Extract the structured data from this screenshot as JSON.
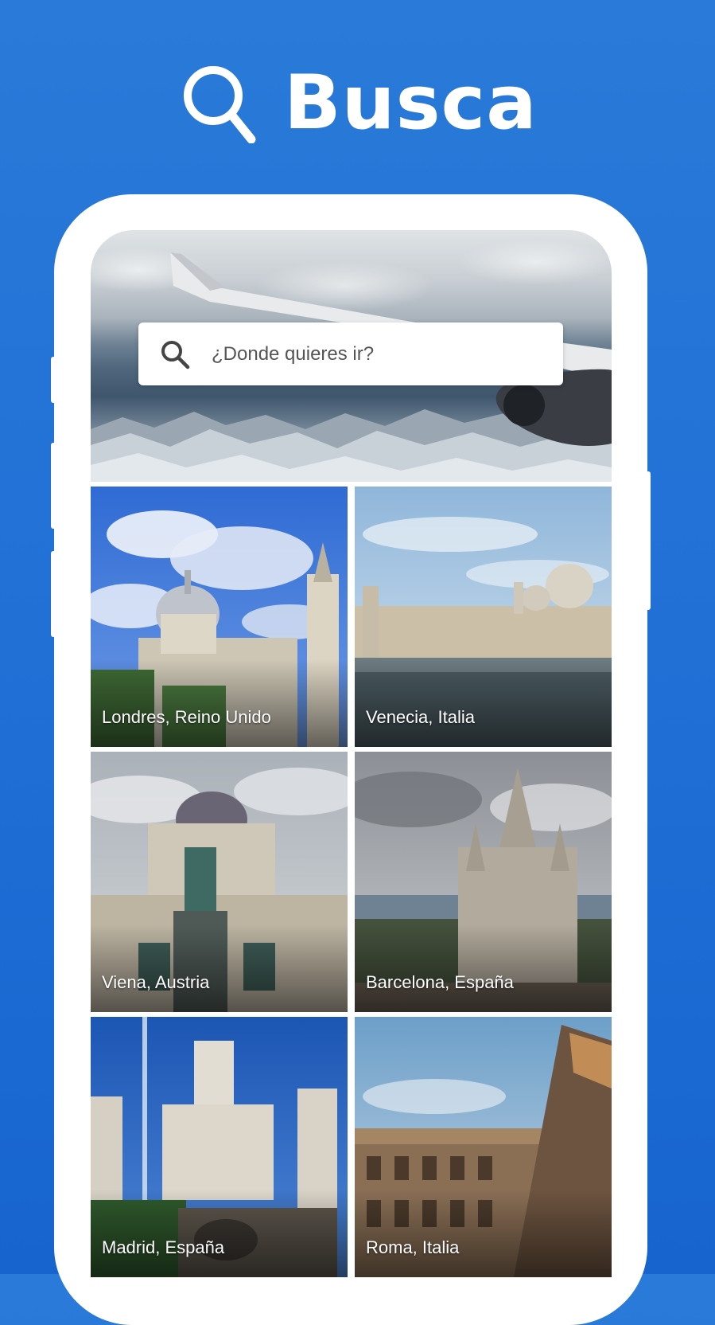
{
  "header": {
    "title": "Busca",
    "icon": "search-icon"
  },
  "search": {
    "placeholder": "¿Donde quieres ir?",
    "icon": "search-icon"
  },
  "destinations": [
    {
      "label": "Londres, Reino Unido"
    },
    {
      "label": "Venecia, Italia"
    },
    {
      "label": "Viena, Austria"
    },
    {
      "label": "Barcelona, España"
    },
    {
      "label": "Madrid, España"
    },
    {
      "label": "Roma, Italia"
    }
  ],
  "colors": {
    "background": "#1f6fd6",
    "frame": "#ffffff",
    "label_text": "#ffffff"
  }
}
